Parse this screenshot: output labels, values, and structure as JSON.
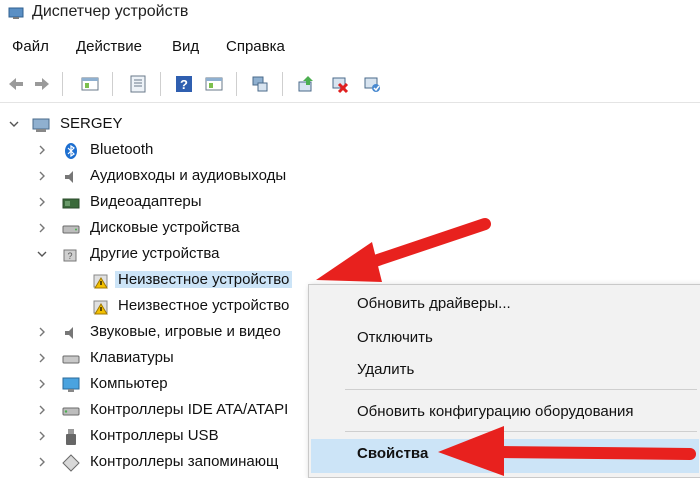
{
  "window": {
    "title": "Диспетчер устройств"
  },
  "menu": [
    "Файл",
    "Действие",
    "Вид",
    "Справка"
  ],
  "tree": {
    "root": "SERGEY",
    "items": [
      "Bluetooth",
      "Аудиовходы и аудиовыходы",
      "Видеоадаптеры",
      "Дисковые устройства",
      "Другие устройства",
      "Неизвестное устройство",
      "Неизвестное устройство",
      "Звуковые, игровые и видео",
      "Клавиатуры",
      "Компьютер",
      "Контроллеры IDE ATA/ATAPI",
      "Контроллеры USB",
      "Контроллеры запоминающ"
    ]
  },
  "context_menu": {
    "items": [
      "Обновить драйверы...",
      "Отключить",
      "Удалить",
      "Обновить конфигурацию оборудования",
      "Свойства"
    ]
  },
  "colors": {
    "selection": "#cce4f7",
    "arrow": "#e8211e",
    "warning": "#f3c000"
  }
}
